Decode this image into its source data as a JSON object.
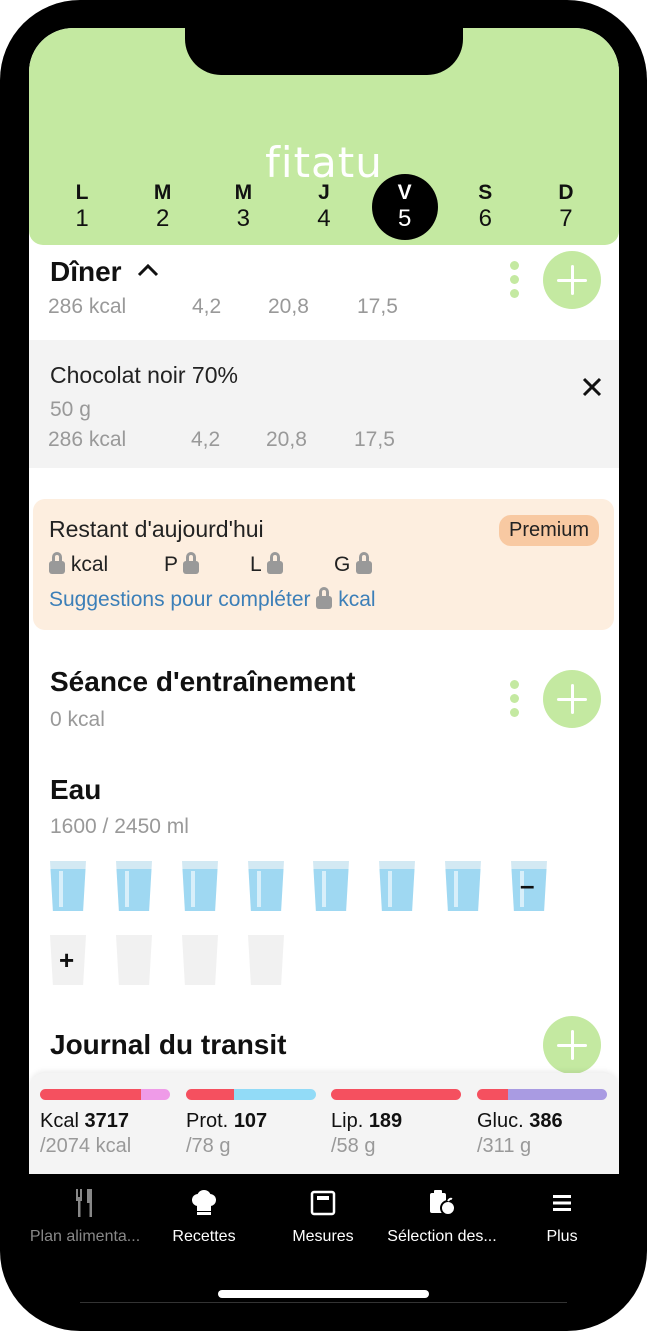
{
  "app": {
    "logo": "fitatu"
  },
  "week": [
    {
      "letter": "L",
      "num": "1"
    },
    {
      "letter": "M",
      "num": "2"
    },
    {
      "letter": "M",
      "num": "3"
    },
    {
      "letter": "J",
      "num": "4"
    },
    {
      "letter": "V",
      "num": "5",
      "active": true
    },
    {
      "letter": "S",
      "num": "6"
    },
    {
      "letter": "D",
      "num": "7"
    }
  ],
  "dinner": {
    "title": "Dîner",
    "kcal": "286 kcal",
    "p": "4,2",
    "l": "20,8",
    "g": "17,5",
    "item": {
      "name": "Chocolat noir 70%",
      "qty": "50 g",
      "kcal": "286 kcal",
      "p": "4,2",
      "l": "20,8",
      "g": "17,5"
    }
  },
  "remaining": {
    "title": "Restant d'aujourd'hui",
    "badge": "Premium",
    "kcal": "kcal",
    "p": "P",
    "l": "L",
    "g": "G",
    "suggest": "Suggestions pour compléter",
    "suggest_unit": "kcal"
  },
  "training": {
    "title": "Séance d'entraînement",
    "kcal": "0 kcal"
  },
  "water": {
    "title": "Eau",
    "amount": "1600 / 2450 ml",
    "filled": 8,
    "total": 12,
    "minus": "–",
    "plus": "+"
  },
  "transit": {
    "title": "Journal du transit"
  },
  "summary": [
    {
      "label": "Kcal",
      "value": "3717",
      "target": "/2074 kcal",
      "colors": [
        "#f5505f",
        "#ef9be8"
      ],
      "split": 0.78
    },
    {
      "label": "Prot.",
      "value": "107",
      "target": "/78 g",
      "colors": [
        "#f5505f",
        "#92dbf7"
      ],
      "split": 0.37
    },
    {
      "label": "Lip.",
      "value": "189",
      "target": "/58 g",
      "colors": [
        "#f5505f",
        "#f5505f"
      ],
      "split": 1.0
    },
    {
      "label": "Gluc.",
      "value": "386",
      "target": "/311 g",
      "colors": [
        "#f5505f",
        "#a99be2"
      ],
      "split": 0.24
    }
  ],
  "tabs": [
    {
      "label": "Plan alimenta...",
      "icon": "fork-knife-icon"
    },
    {
      "label": "Recettes",
      "icon": "chef-hat-icon"
    },
    {
      "label": "Mesures",
      "icon": "scale-icon"
    },
    {
      "label": "Sélection des...",
      "icon": "clipboard-apple-icon"
    },
    {
      "label": "Plus",
      "icon": "menu-icon"
    }
  ]
}
